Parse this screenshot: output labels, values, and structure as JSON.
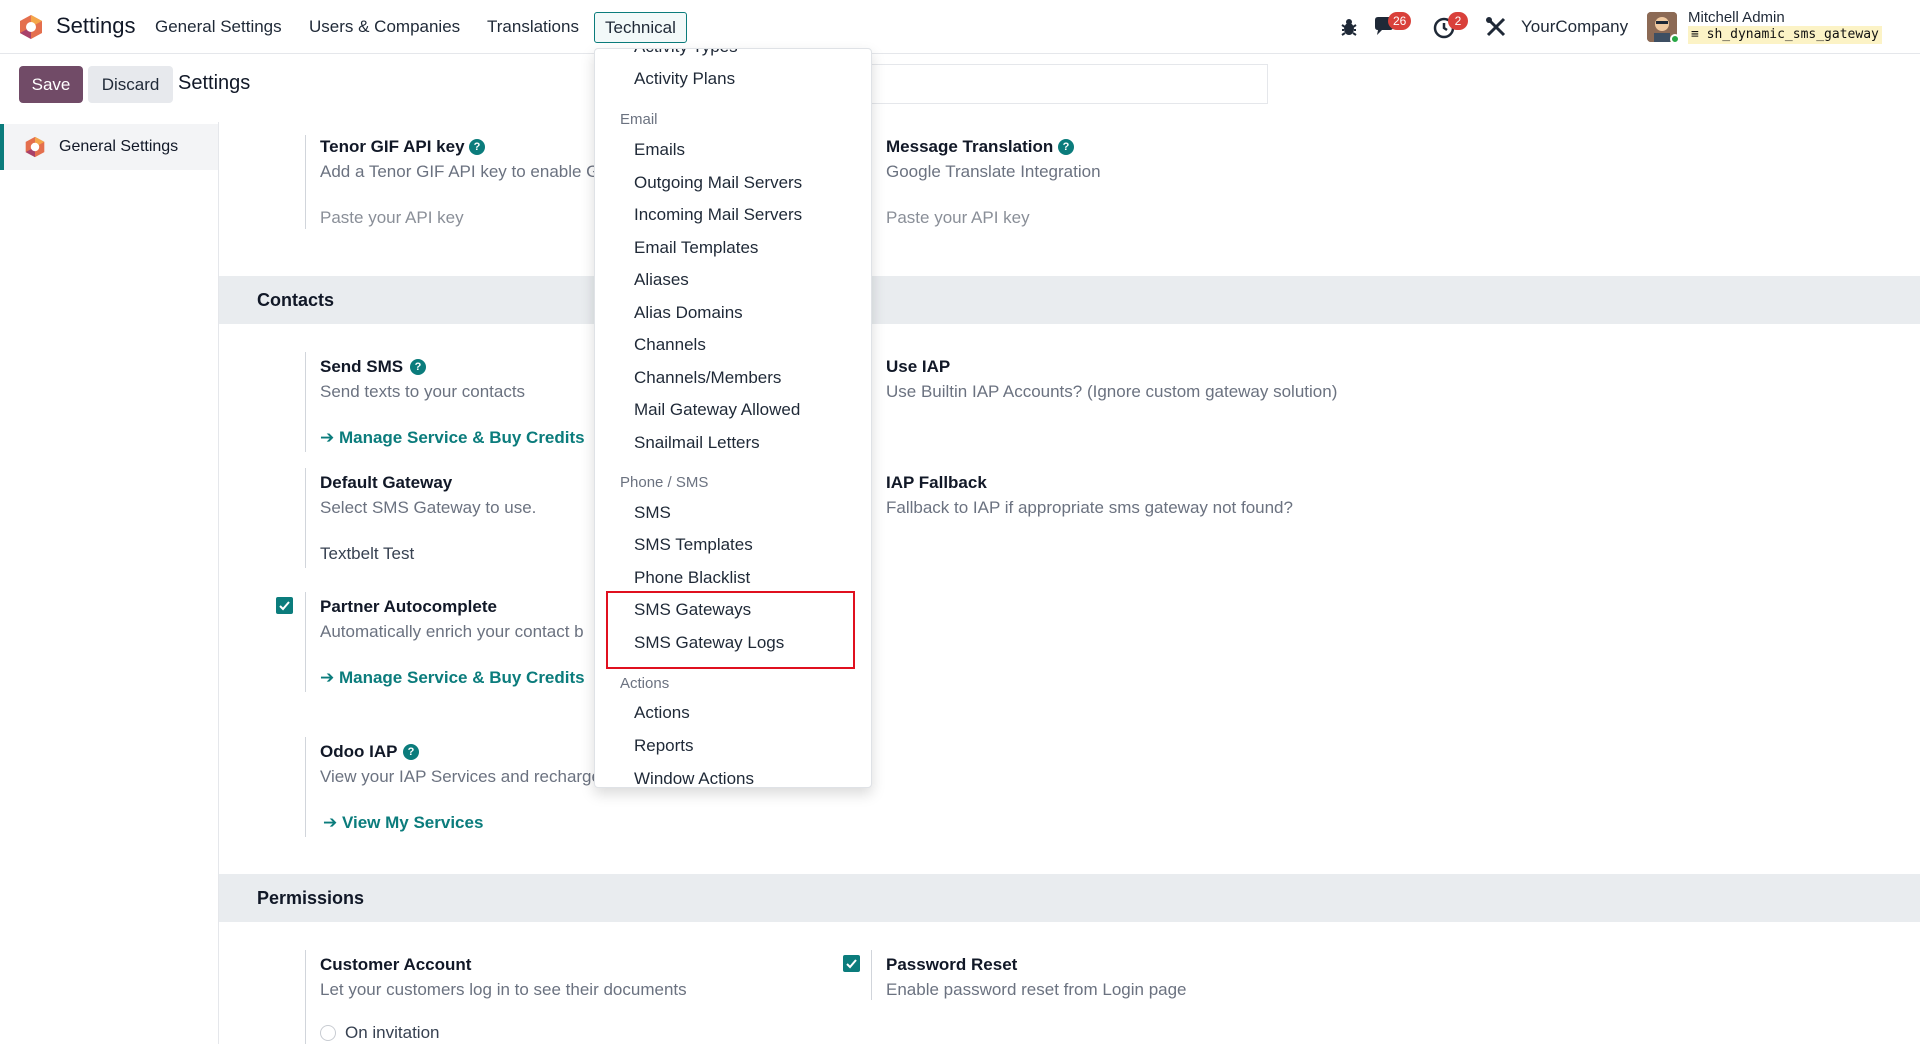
{
  "navbar": {
    "app_name": "Settings",
    "menus": [
      "General Settings",
      "Users & Companies",
      "Translations",
      "Technical"
    ],
    "active_menu": "Technical",
    "messages_count": "26",
    "activities_count": "2",
    "company": "YourCompany",
    "user": "Mitchell Admin",
    "database": "sh_dynamic_sms_gateway",
    "icons": [
      "odoo-logo",
      "bug-icon",
      "chat-icon",
      "clock-icon",
      "tools-icon"
    ]
  },
  "control_panel": {
    "save": "Save",
    "discard": "Discard",
    "title": "Settings"
  },
  "sidebar": {
    "items": [
      {
        "label": "General Settings"
      }
    ]
  },
  "dropdown": {
    "top_cut": "Activity Types",
    "top_items": [
      "Activity Plans"
    ],
    "email_header": "Email",
    "email_items": [
      "Emails",
      "Outgoing Mail Servers",
      "Incoming Mail Servers",
      "Email Templates",
      "Aliases",
      "Alias Domains",
      "Channels",
      "Channels/Members",
      "Mail Gateway Allowed",
      "Snailmail Letters"
    ],
    "phone_header": "Phone / SMS",
    "phone_items": [
      "SMS",
      "SMS Templates",
      "Phone Blacklist",
      "SMS Gateways",
      "SMS Gateway Logs"
    ],
    "actions_header": "Actions",
    "actions_items": [
      "Actions",
      "Reports",
      "Window Actions"
    ]
  },
  "content": {
    "tenor": {
      "title": "Tenor GIF API key",
      "desc": "Add a Tenor GIF API key to enable G",
      "placeholder": "Paste your API key"
    },
    "translation": {
      "title": "Message Translation",
      "desc": "Google Translate Integration",
      "placeholder": "Paste your API key"
    },
    "contacts_section": "Contacts",
    "send_sms": {
      "title": "Send SMS",
      "desc": "Send texts to your contacts",
      "link": "Manage Service & Buy Credits"
    },
    "use_iap": {
      "title": "Use IAP",
      "desc": "Use Builtin IAP Accounts? (Ignore custom gateway solution)"
    },
    "default_gateway": {
      "title": "Default Gateway",
      "desc": "Select SMS Gateway to use.",
      "value": "Textbelt Test"
    },
    "iap_fallback": {
      "title": "IAP Fallback",
      "desc": "Fallback to IAP if appropriate sms gateway not found?"
    },
    "partner_autocomplete": {
      "title": "Partner Autocomplete",
      "desc": "Automatically enrich your contact b",
      "link": "Manage Service & Buy Credits",
      "checked": true
    },
    "odoo_iap": {
      "title": "Odoo IAP",
      "desc": "View your IAP Services and recharge your credits",
      "link": "View My Services"
    },
    "permissions_section": "Permissions",
    "customer_account": {
      "title": "Customer Account",
      "desc": "Let your customers log in to see their documents",
      "option": "On invitation"
    },
    "password_reset": {
      "title": "Password Reset",
      "desc": "Enable password reset from Login page",
      "checked": true
    }
  },
  "colors": {
    "brand": "#714b67",
    "accent": "#0b7c7c",
    "badge": "#d9403a",
    "highlight": "#e0101f"
  }
}
